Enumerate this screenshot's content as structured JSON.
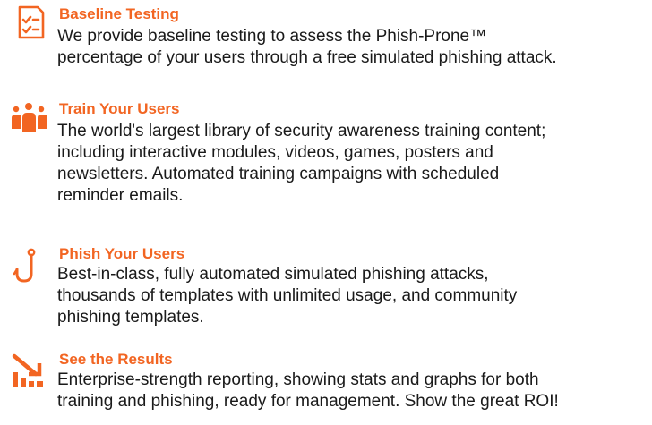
{
  "features": [
    {
      "icon": "checklist-icon",
      "title": "Baseline Testing",
      "lines": [
        "We provide baseline testing to assess the Phish-Prone™",
        "percentage of your users through a free simulated phishing attack."
      ]
    },
    {
      "icon": "users-group-icon",
      "title": "Train Your Users",
      "lines": [
        "The world's largest library of security awareness training content;",
        "including interactive modules, videos, games, posters and",
        "newsletters. Automated training campaigns with scheduled",
        "reminder emails."
      ]
    },
    {
      "icon": "fishing-hook-icon",
      "title": "Phish Your Users",
      "lines": [
        "Best-in-class, fully automated simulated phishing attacks,",
        "thousands of templates with unlimited usage, and community",
        "phishing templates."
      ]
    },
    {
      "icon": "results-chart-icon",
      "title": "See the Results",
      "lines": [
        "Enterprise-strength reporting, showing stats and graphs for both",
        "training and phishing, ready for management. Show the great ROI!"
      ]
    }
  ],
  "colors": {
    "accent": "#f26522",
    "text": "#1a1a1a"
  }
}
